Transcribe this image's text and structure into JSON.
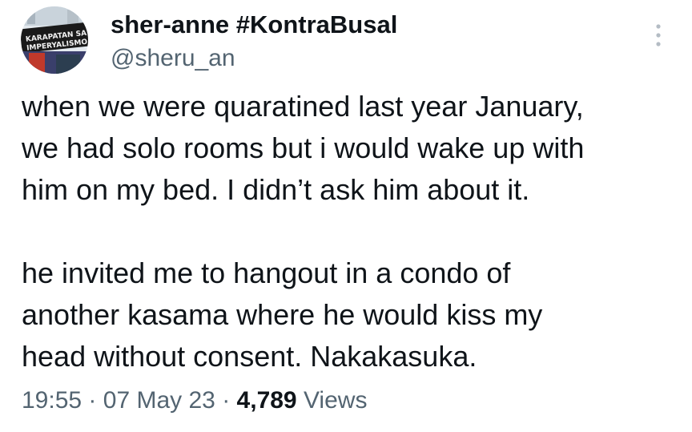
{
  "tweet": {
    "author": {
      "display_name": "sher-anne #KontraBusal",
      "handle": "@sheru_an",
      "avatar_banner_text": "KARAPATAN SA IMPERYALISMO"
    },
    "paragraphs": [
      "when we were quaratined last year January,\nwe had solo rooms but i would wake up with\nhim on my bed. I didn’t ask him about it.",
      "he invited me to hangout in a condo of\nanother kasama where he would kiss my\nhead without consent. Nakakasuka."
    ],
    "time": "19:55",
    "date": "07 May 23",
    "separator": "·",
    "views_count": "4,789",
    "views_label": "Views"
  },
  "icons": {
    "more": "more-vertical-icon"
  },
  "colors": {
    "text_primary": "#0f1419",
    "text_secondary": "#536471",
    "more_icon": "#b4bcc4"
  }
}
